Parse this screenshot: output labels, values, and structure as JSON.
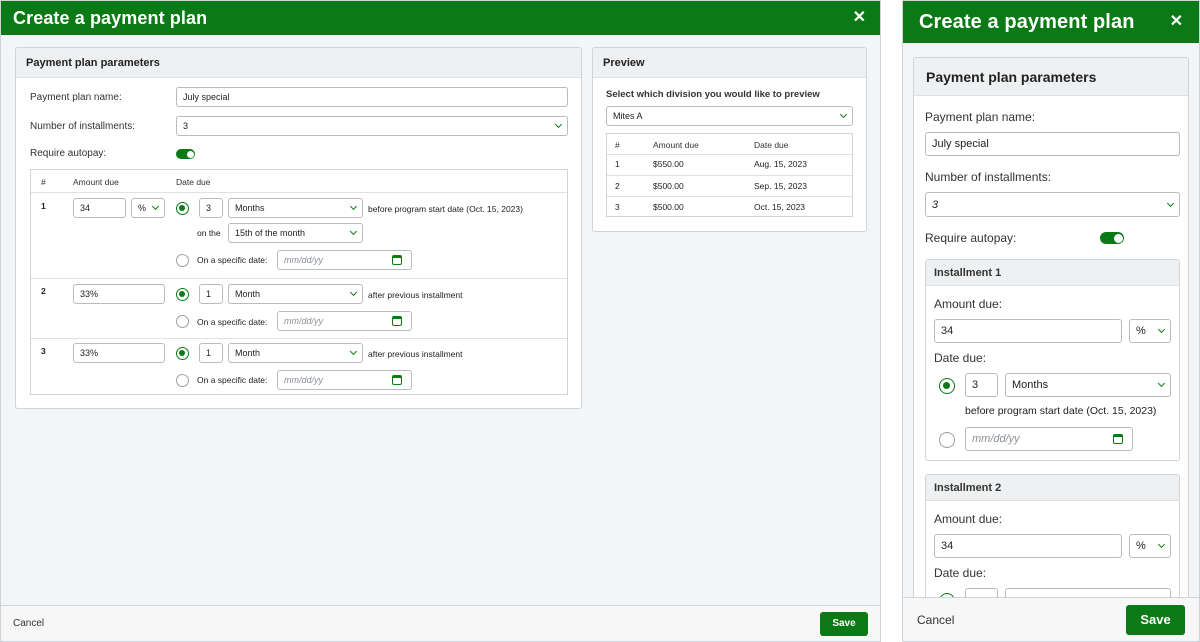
{
  "title": "Create a payment plan",
  "parameters": {
    "heading": "Payment plan parameters",
    "name_label": "Payment plan name:",
    "name_value": "July special",
    "installments_label": "Number of installments:",
    "installments_value": "3",
    "autopay_label": "Require autopay:",
    "autopay_on": true
  },
  "table": {
    "col_num": "#",
    "col_amount": "Amount due",
    "col_date": "Date due",
    "on_the": "on the",
    "specific_date": "On a specific date:",
    "date_placeholder": "mm/dd/yy",
    "rows": [
      {
        "num": "1",
        "amount": "34",
        "unit": "%",
        "count": "3",
        "period": "Months",
        "relation": "before program start date (Oct. 15, 2023)",
        "day": "15th of the month"
      },
      {
        "num": "2",
        "amount": "33%",
        "count": "1",
        "period": "Month",
        "relation": "after previous installment"
      },
      {
        "num": "3",
        "amount": "33%",
        "count": "1",
        "period": "Month",
        "relation": "after previous installment"
      }
    ]
  },
  "preview": {
    "heading": "Preview",
    "select_label": "Select which division you would like to preview",
    "division": "Mites A",
    "col_num": "#",
    "col_amount": "Amount due",
    "col_date": "Date due",
    "rows": [
      {
        "num": "1",
        "amount": "$550.00",
        "date": "Aug. 15, 2023"
      },
      {
        "num": "2",
        "amount": "$500.00",
        "date": "Sep. 15, 2023"
      },
      {
        "num": "3",
        "amount": "$500.00",
        "date": "Oct. 15, 2023"
      }
    ]
  },
  "mobile": {
    "installment1": "Installment 1",
    "installment2": "Installment 2",
    "amount_label": "Amount due:",
    "date_label": "Date due:",
    "inst1_amount": "34",
    "inst1_unit": "%",
    "inst1_count": "3",
    "inst1_period": "Months",
    "inst1_relation": "before program start date (Oct. 15, 2023)",
    "inst2_amount": "34",
    "inst2_unit": "%"
  },
  "footer": {
    "cancel": "Cancel",
    "save": "Save"
  },
  "colors": {
    "brand": "#0b7a16"
  },
  "icons": [
    "close-icon",
    "chevron-down-icon",
    "calendar-icon",
    "toggle-switch",
    "radio-button"
  ]
}
